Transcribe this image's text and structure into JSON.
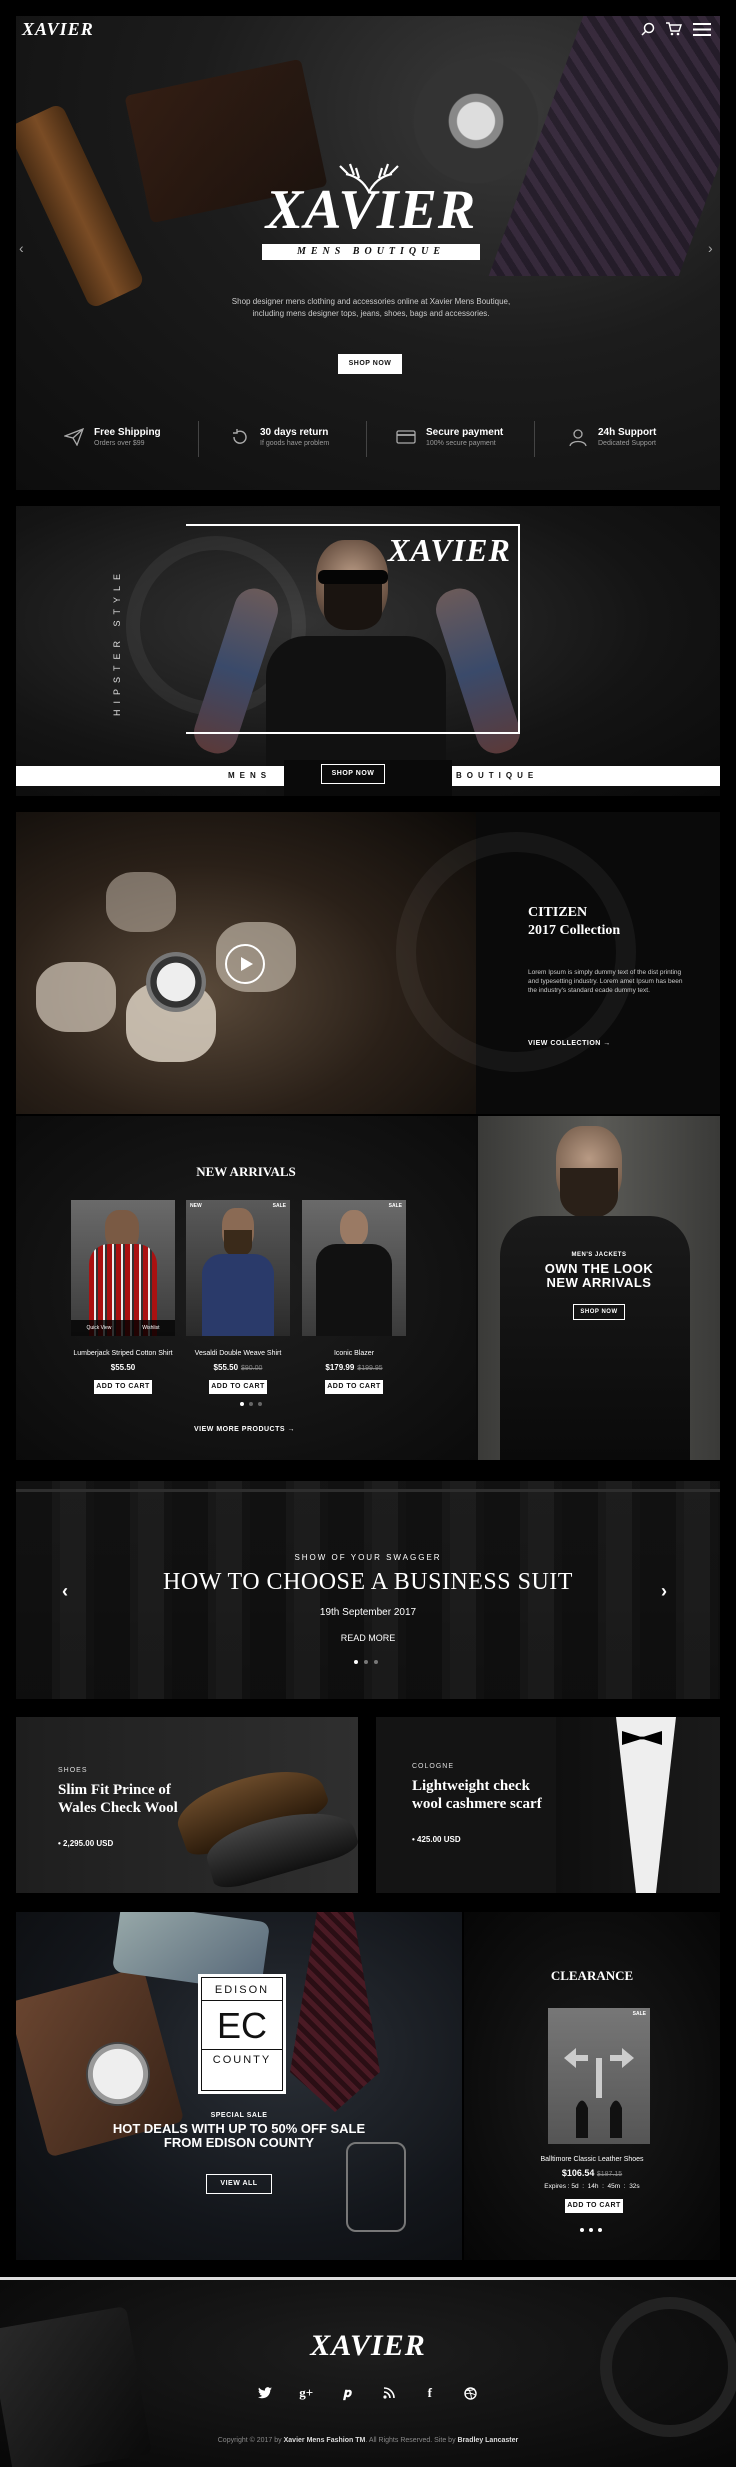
{
  "header": {
    "logo": "XAVIER",
    "icons": [
      "search-icon",
      "cart-icon",
      "menu-icon"
    ]
  },
  "hero": {
    "logo": "XAVIER",
    "tagline": "MENS BOUTIQUE",
    "description_line1": "Shop designer mens clothing and accessories online at Xavier Mens Boutique,",
    "description_line2": "including mens designer tops, jeans, shoes, bags and accessories.",
    "cta": "SHOP NOW",
    "features": [
      {
        "title": "Free Shipping",
        "subtitle": "Orders over $99",
        "icon": "paper-plane-icon"
      },
      {
        "title": "30 days return",
        "subtitle": "If goods have problem",
        "icon": "return-icon"
      },
      {
        "title": "Secure payment",
        "subtitle": "100% secure payment",
        "icon": "credit-card-icon"
      },
      {
        "title": "24h Support",
        "subtitle": "Dedicated Support",
        "icon": "support-icon"
      }
    ]
  },
  "banner2": {
    "logo": "XAVIER",
    "vertical_text": "HIPSTER STYLE",
    "left_label": "MENS",
    "right_label": "BOUTIQUE",
    "cta": "SHOP NOW"
  },
  "citizen": {
    "title_line1": "CITIZEN",
    "title_line2": "2017 Collection",
    "body": "Lorem Ipsum is simply dummy text of the dist printing and typesetting industry. Lorem amet Ipsum has been the industry's standard ecade dummy text.",
    "link": "VIEW COLLECTION →"
  },
  "new_arrivals": {
    "heading": "NEW ARRIVALS",
    "products": [
      {
        "name": "Lumberjack Striped Cotton Shirt",
        "price": "$55.50",
        "old_price": "",
        "badges": [],
        "quick_view": "Quick View",
        "wishlist": "Wishlist"
      },
      {
        "name": "Vesaldi Double Weave Shirt",
        "price": "$55.50",
        "old_price": "$90.00",
        "badges": [
          "NEW",
          "SALE"
        ]
      },
      {
        "name": "Iconic Blazer",
        "price": "$179.99",
        "old_price": "$199.95",
        "badges": [
          "SALE"
        ]
      }
    ],
    "add_to_cart": "ADD TO CART",
    "view_more": "VIEW MORE PRODUCTS →",
    "side_small": "MEN'S JACKETS",
    "side_title_line1": "OWN THE LOOK",
    "side_title_line2": "NEW ARRIVALS",
    "side_cta": "SHOP NOW"
  },
  "slider": {
    "eyebrow": "SHOW OF YOUR SWAGGER",
    "title": "HOW TO CHOOSE A BUSINESS SUIT",
    "date": "19th September 2017",
    "link": "READ MORE"
  },
  "promos": [
    {
      "category": "SHOES",
      "title_line1": "Slim Fit Prince of",
      "title_line2": "Wales Check Wool",
      "price": "• 2,295.00 USD"
    },
    {
      "category": "COLOGNE",
      "title_line1": "Lightweight check",
      "title_line2": "wool cashmere scarf",
      "price": "• 425.00 USD"
    }
  ],
  "edison": {
    "logo_top": "EDISON",
    "logo_mid": "EC",
    "logo_bottom": "COUNTY",
    "small": "SPECIAL SALE",
    "title_line1": "HOT DEALS WITH UP TO 50% OFF SALE",
    "title_line2": "FROM EDISON COUNTY",
    "cta": "VIEW ALL"
  },
  "clearance": {
    "heading": "CLEARANCE",
    "badge": "SALE",
    "product_name": "Balltimore Classic Leather Shoes",
    "price": "$106.54",
    "old_price": "$187.15",
    "countdown": "Expires : 5d  :  14h  :  45m  :  32s",
    "cta": "ADD TO CART"
  },
  "footer": {
    "logo": "XAVIER",
    "social": [
      {
        "icon": "twitter-icon",
        "glyph": "𝕥"
      },
      {
        "icon": "google-plus-icon",
        "glyph": "g+"
      },
      {
        "icon": "pinterest-icon",
        "glyph": "P"
      },
      {
        "icon": "rss-icon",
        "glyph": "◔"
      },
      {
        "icon": "facebook-icon",
        "glyph": "f"
      },
      {
        "icon": "dribbble-icon",
        "glyph": "◎"
      }
    ],
    "copyright_prefix": "Copyright © 2017 by",
    "copyright_brand": "Xavier Mens Fashion TM",
    "copyright_middle": ". All Rights Reserved. Site by",
    "copyright_author": "Bradley Lancaster"
  }
}
